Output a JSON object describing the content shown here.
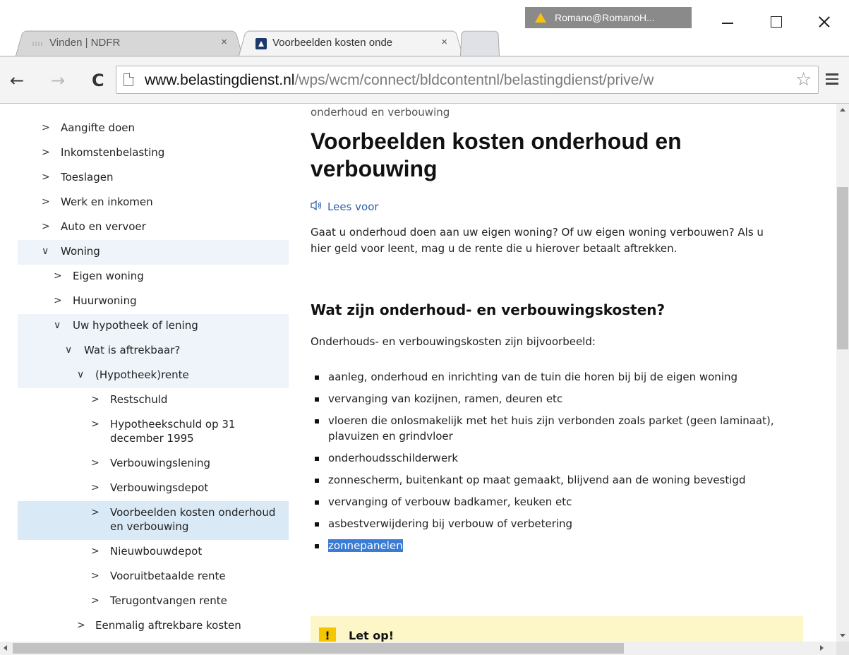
{
  "window": {
    "profile_label": "Romano@RomanoH...",
    "controls": {
      "minimize": "minimize",
      "maximize": "maximize",
      "close": "close"
    }
  },
  "tabs": [
    {
      "label": "Vinden | NDFR",
      "close": "×",
      "active": false
    },
    {
      "label": "Voorbeelden kosten onde",
      "close": "×",
      "active": true
    }
  ],
  "toolbar": {
    "back": "←",
    "forward": "→",
    "reload": "C",
    "url_host": "www.belastingdienst.nl",
    "url_path": "/wps/wcm/connect/bldcontentnl/belastingdienst/prive/w",
    "star": "☆"
  },
  "sidebar": {
    "items": [
      {
        "label": "Aangifte doen",
        "level": 0,
        "chevron": ">",
        "state": "normal"
      },
      {
        "label": "Inkomstenbelasting",
        "level": 0,
        "chevron": ">",
        "state": "normal"
      },
      {
        "label": "Toeslagen",
        "level": 0,
        "chevron": ">",
        "state": "normal"
      },
      {
        "label": "Werk en inkomen",
        "level": 0,
        "chevron": ">",
        "state": "normal"
      },
      {
        "label": "Auto en vervoer",
        "level": 0,
        "chevron": ">",
        "state": "normal"
      },
      {
        "label": "Woning",
        "level": 0,
        "chevron": "∨",
        "state": "expanded"
      },
      {
        "label": "Eigen woning",
        "level": 1,
        "chevron": ">",
        "state": "normal"
      },
      {
        "label": "Huurwoning",
        "level": 1,
        "chevron": ">",
        "state": "normal"
      },
      {
        "label": "Uw hypotheek of lening",
        "level": 1,
        "chevron": "∨",
        "state": "expanded"
      },
      {
        "label": "Wat is aftrekbaar?",
        "level": 2,
        "chevron": "∨",
        "state": "expanded"
      },
      {
        "label": "(Hypotheek)rente",
        "level": 3,
        "chevron": "∨",
        "state": "expanded"
      },
      {
        "label": "Restschuld",
        "level": 4,
        "chevron": ">",
        "state": "normal"
      },
      {
        "label": "Hypotheekschuld op 31 december 1995",
        "level": 4,
        "chevron": ">",
        "state": "normal"
      },
      {
        "label": "Verbouwingslening",
        "level": 4,
        "chevron": ">",
        "state": "normal"
      },
      {
        "label": "Verbouwingsdepot",
        "level": 4,
        "chevron": ">",
        "state": "normal"
      },
      {
        "label": "Voorbeelden kosten onderhoud en verbouwing",
        "level": 4,
        "chevron": ">",
        "state": "active"
      },
      {
        "label": "Nieuwbouwdepot",
        "level": 4,
        "chevron": ">",
        "state": "normal"
      },
      {
        "label": "Vooruitbetaalde rente",
        "level": 4,
        "chevron": ">",
        "state": "normal"
      },
      {
        "label": "Terugontvangen rente",
        "level": 4,
        "chevron": ">",
        "state": "normal"
      },
      {
        "label": "Eenmalig aftrekbare kosten",
        "level": 3,
        "chevron": ">",
        "state": "normal"
      }
    ]
  },
  "content": {
    "breadcrumb_tail": "onderhoud en verbouwing",
    "title": "Voorbeelden kosten onderhoud en verbouwing",
    "read_aloud": "Lees voor",
    "intro": "Gaat u onderhoud doen aan uw eigen woning? Of uw eigen woning verbouwen? Als u hier geld voor leent, mag u de rente die u hierover betaalt aftrekken.",
    "heading": "Wat zijn onderhoud- en verbouwingskosten?",
    "lead": "Onderhouds- en verbouwingskosten zijn bijvoorbeeld:",
    "bullets": [
      "aanleg, onderhoud en inrichting van de tuin die horen bij bij de eigen woning",
      "vervanging van kozijnen, ramen, deuren etc",
      "vloeren die onlosmakelijk met het huis zijn verbonden zoals parket (geen laminaat), plavuizen en grindvloer",
      "onderhoudsschilderwerk",
      "zonnescherm, buitenkant op maat gemaakt, blijvend aan de woning bevestigd",
      "vervanging of verbouw badkamer, keuken etc",
      "asbestverwijdering bij verbouw of verbetering",
      "zonnepanelen"
    ],
    "selected_bullet_index": 7,
    "notice_icon": "!",
    "notice_title": "Let op!"
  },
  "scroll": {
    "vertical_fraction": 0.09,
    "horizontal_fraction": 0.0
  },
  "colors": {
    "link": "#2f5fa8",
    "selection": "#3a7bd5",
    "notice_bg": "#fdf6c7",
    "notice_icon": "#f5c500",
    "nav_active": "#d9e9f6",
    "nav_expanded": "#eef4fa"
  }
}
